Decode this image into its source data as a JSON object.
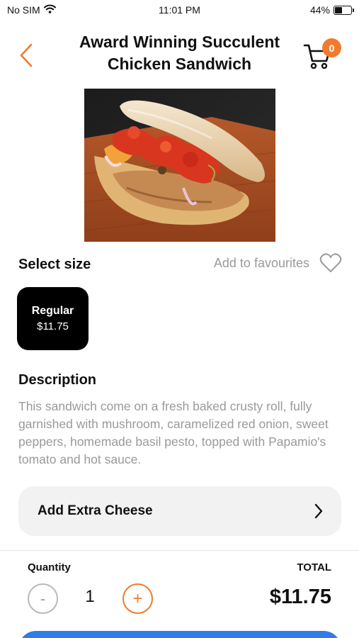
{
  "status_bar": {
    "carrier": "No SIM",
    "time": "11:01 PM",
    "battery": "44%",
    "battery_level": 0.44
  },
  "header": {
    "title": "Award Winning Succulent Chicken Sandwich",
    "cart_count": "0"
  },
  "size_section": {
    "label": "Select size",
    "favourites_label": "Add to favourites",
    "options": [
      {
        "name": "Regular",
        "price": "$11.75",
        "selected": true
      }
    ]
  },
  "description": {
    "label": "Description",
    "text": "This sandwich come on a fresh baked crusty roll, fully garnished with mushroom, caramelized red onion, sweet peppers, homemade basil pesto, topped with Papamio's tomato and hot sauce."
  },
  "extras": {
    "label": "Add Extra Cheese"
  },
  "footer": {
    "quantity_label": "Quantity",
    "total_label": "TOTAL",
    "quantity": "1",
    "minus_symbol": "-",
    "plus_symbol": "+",
    "total": "$11.75"
  },
  "colors": {
    "accent": "#f07b2e",
    "primary_button": "#2f7de6",
    "muted_text": "#9a9a9a"
  }
}
